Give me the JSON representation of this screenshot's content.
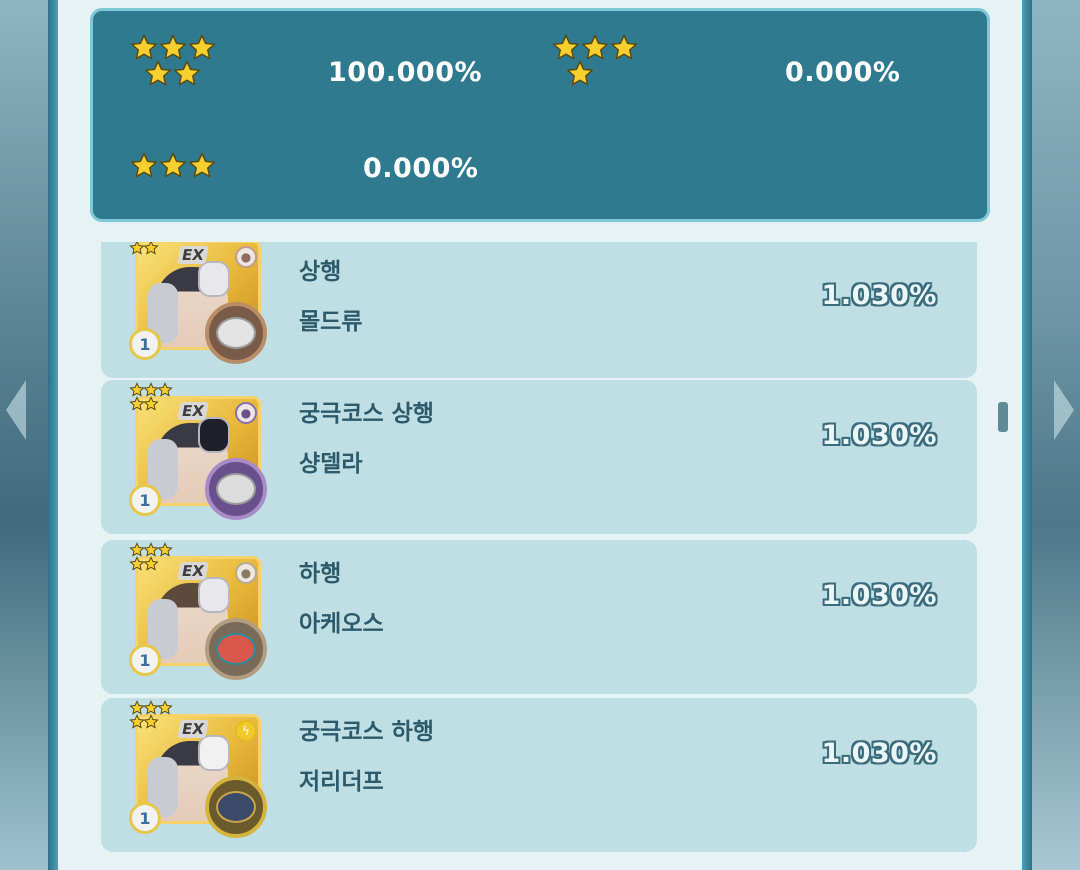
{
  "summary": {
    "items": [
      {
        "stars": 5,
        "percent": "100.000%"
      },
      {
        "stars": 4,
        "percent": "0.000%"
      },
      {
        "stars": 3,
        "percent": "0.000%"
      }
    ]
  },
  "rows": [
    {
      "trainer": "상행",
      "pokemon": "몰드류",
      "rate": "1.030%",
      "level": "1",
      "ex": "EX",
      "type_icon": "fighting-type-icon",
      "type_color": "#c49b8a",
      "poke_color": "#7a5b47",
      "poke_ring": "#b88d68"
    },
    {
      "trainer": "궁극코스 상행",
      "pokemon": "샹델라",
      "rate": "1.030%",
      "level": "1",
      "ex": "EX",
      "type_icon": "ghost-type-icon",
      "type_color": "#8b6fa8",
      "poke_color": "#6a4f8d",
      "poke_ring": "#a98bc8"
    },
    {
      "trainer": "하행",
      "pokemon": "아케오스",
      "rate": "1.030%",
      "level": "1",
      "ex": "EX",
      "type_icon": "flying-type-icon",
      "type_color": "#b7a98f",
      "poke_color": "#7a6a58",
      "poke_ring": "#b39d80"
    },
    {
      "trainer": "궁극코스 하행",
      "pokemon": "저리더프",
      "rate": "1.030%",
      "level": "1",
      "ex": "EX",
      "type_icon": "electric-type-icon",
      "type_color": "#e3b92c",
      "poke_color": "#6b5a2c",
      "poke_ring": "#d4b43d"
    }
  ],
  "colors": {
    "summary_bg": "#2f7a8f",
    "row_bg": "#bfdfe4",
    "star": "#f7cf2f",
    "text_dark": "#2c5a6b"
  }
}
